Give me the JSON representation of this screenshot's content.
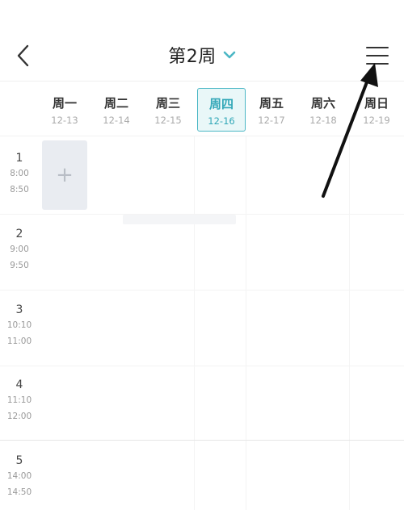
{
  "header": {
    "back_icon": "chevron-left-icon",
    "week_title": "第2周",
    "dropdown_icon": "chevron-down-icon",
    "menu_icon": "hamburger-menu-icon",
    "accent_color": "#4bb7c5"
  },
  "days": [
    {
      "name": "周一",
      "date": "12-13",
      "today": false
    },
    {
      "name": "周二",
      "date": "12-14",
      "today": false
    },
    {
      "name": "周三",
      "date": "12-15",
      "today": false
    },
    {
      "name": "周四",
      "date": "12-16",
      "today": true
    },
    {
      "name": "周五",
      "date": "12-17",
      "today": false
    },
    {
      "name": "周六",
      "date": "12-18",
      "today": false
    },
    {
      "name": "周日",
      "date": "12-19",
      "today": false
    }
  ],
  "periods": [
    {
      "num": "1",
      "start": "8:00",
      "end": "8:50"
    },
    {
      "num": "2",
      "start": "9:00",
      "end": "9:50"
    },
    {
      "num": "3",
      "start": "10:10",
      "end": "11:00"
    },
    {
      "num": "4",
      "start": "11:10",
      "end": "12:00"
    },
    {
      "num": "5",
      "start": "14:00",
      "end": "14:50"
    }
  ],
  "add_cell": {
    "symbol": "+",
    "icon": "plus-icon"
  },
  "annotation": {
    "icon": "arrow-pointer-icon"
  }
}
